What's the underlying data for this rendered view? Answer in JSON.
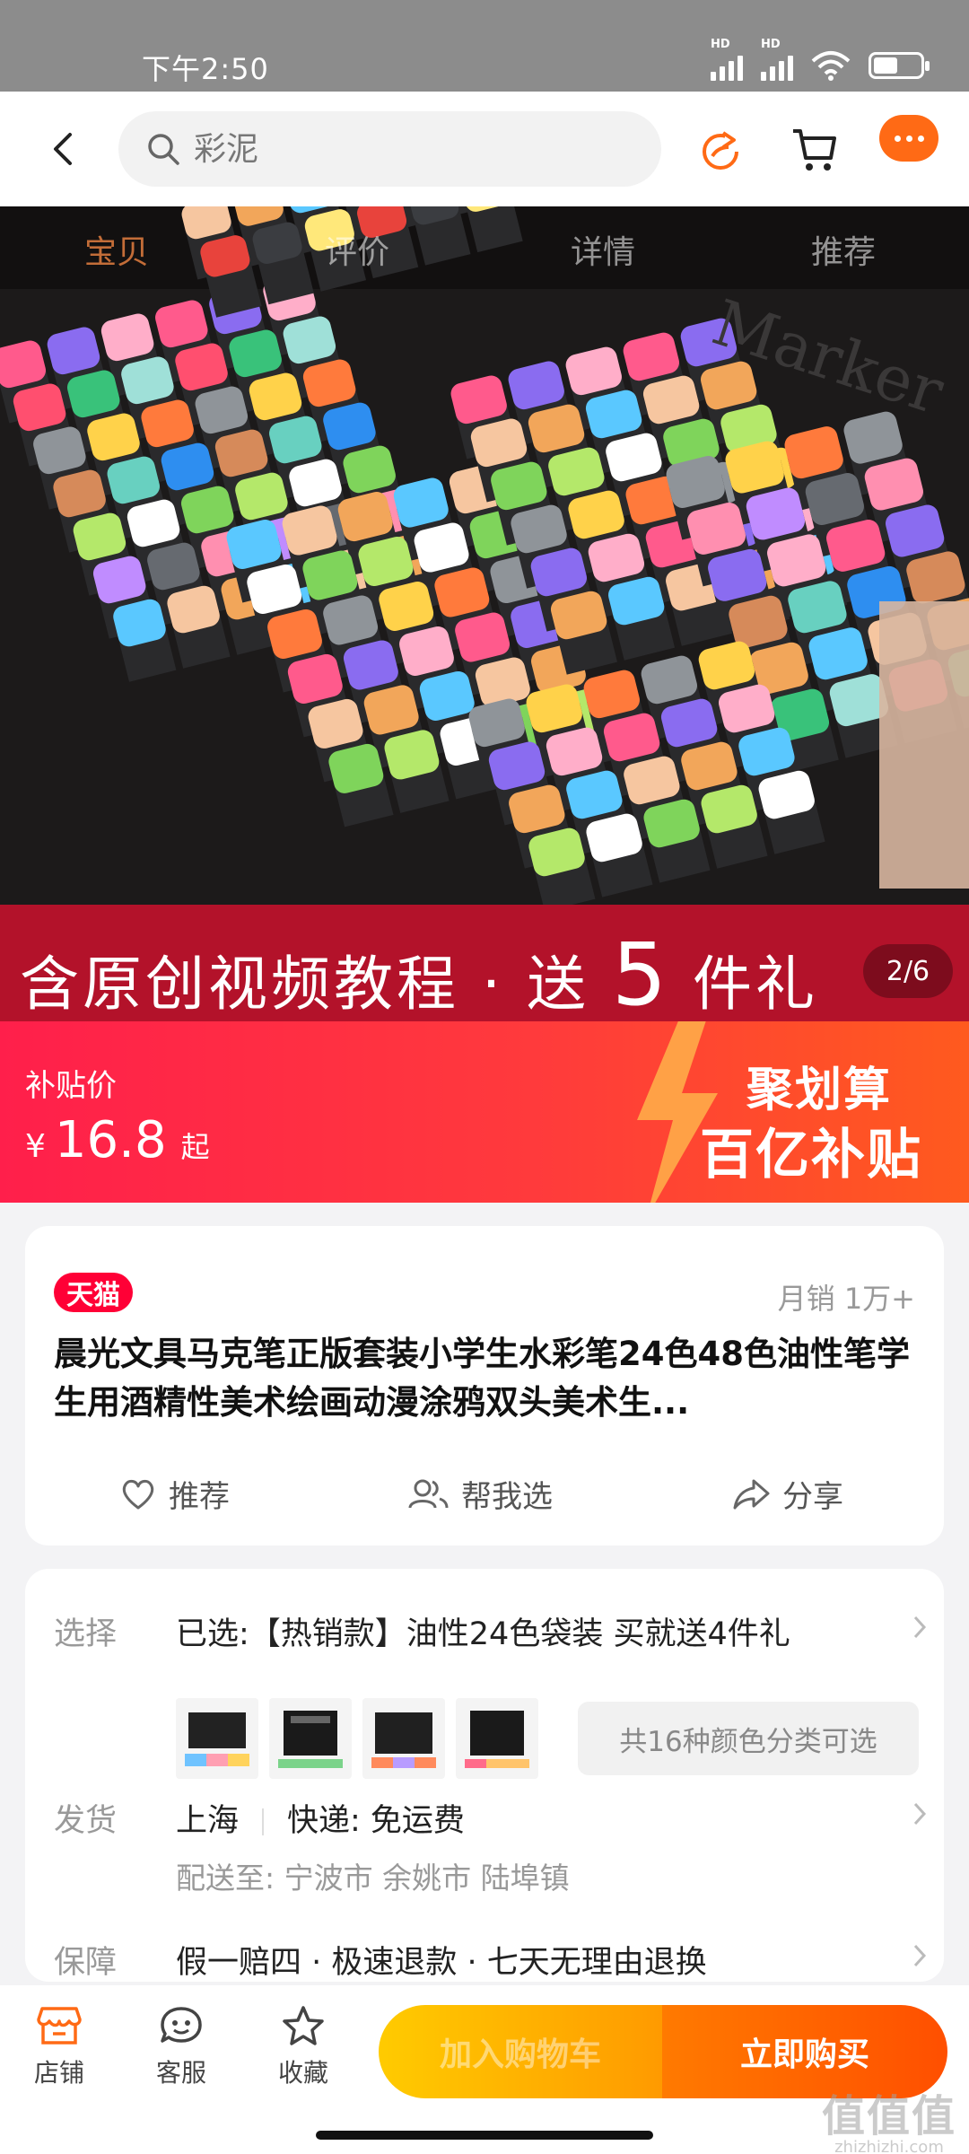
{
  "status_bar": {
    "time": "下午2:50",
    "signal_label": "HD"
  },
  "search": {
    "placeholder": "彩泥"
  },
  "tabs": [
    "宝贝",
    "评价",
    "详情",
    "推荐"
  ],
  "gallery": {
    "promo_text_a": "含原创视频教程 · 送",
    "promo_number": "5",
    "promo_text_b": "件礼",
    "page_indicator": "2/6",
    "marker_brand": "Marker"
  },
  "price": {
    "label": "补贴价",
    "currency": "¥",
    "value": "16.8",
    "suffix": "起",
    "badge_line1": "聚划算",
    "badge_line2": "百亿补贴"
  },
  "product": {
    "store_badge": "天猫",
    "monthly_sales": "月销 1万+",
    "title": "晨光文具马克笔正版套装小学生水彩笔24色48色油性笔学生用酒精性美术绘画动漫涂鸦双头美术生...",
    "actions": {
      "recommend": "推荐",
      "help_choose": "帮我选",
      "share": "分享"
    }
  },
  "details": {
    "select_label": "选择",
    "select_value": "已选:【热销款】油性24色袋装 买就送4件礼",
    "variant_note": "共16种颜色分类可选",
    "ship_label": "发货",
    "ship_from": "上海",
    "ship_method": "快递: 免运费",
    "ship_to": "配送至: 宁波市 余姚市 陆埠镇",
    "guarantee_label": "保障",
    "guarantee_value": "假一赔四 · 极速退款 · 七天无理由退换"
  },
  "bottom_bar": {
    "store": "店铺",
    "service": "客服",
    "favorite": "收藏",
    "add_to_cart": "加入购物车",
    "buy_now": "立即购买"
  },
  "watermark": {
    "line1": "值值值",
    "line2": "zhizhizhi.com"
  },
  "colors": {
    "accent_orange": "#ff6a15",
    "price_red": "#ff1f4b",
    "tmall_red": "#ff0036",
    "promo_strip": "#b3122a"
  }
}
